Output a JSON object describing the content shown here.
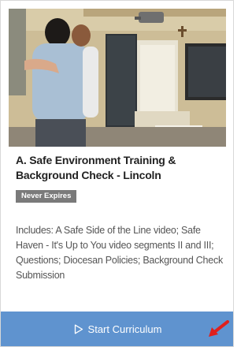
{
  "course_card": {
    "image": {
      "description_icon": "photo-icon",
      "alt": ""
    },
    "title": "A. Safe Environment Training & Background Check - Lincoln",
    "badge": "Never Expires",
    "description": "Includes: A Safe Side of the Line video; Safe Haven - It's Up to You video segments II and III; Questions; Diocesan Policies; Background Check Submission",
    "start_button": {
      "label": "Start Curriculum",
      "icon": "play-outline-icon"
    },
    "annotation": {
      "icon": "red-arrow-icon"
    }
  },
  "colors": {
    "button_bg": "#5f93cf",
    "badge_bg": "#7a7a7a",
    "annotation_red": "#e0201c"
  }
}
